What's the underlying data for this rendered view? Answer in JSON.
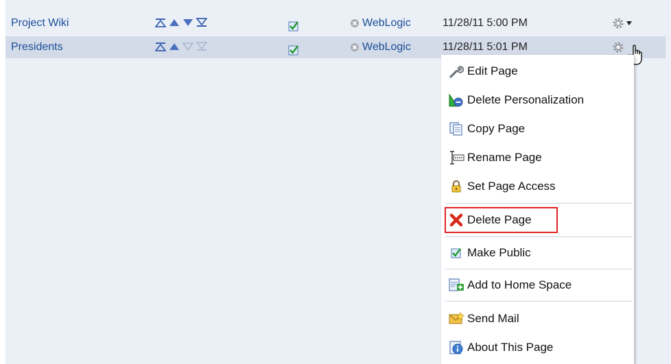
{
  "rows": [
    {
      "name": "Project Wiki",
      "published": true,
      "owner": "WebLogic",
      "modified": "11/28/11 5:00 PM"
    },
    {
      "name": "Presidents",
      "published": true,
      "owner": "WebLogic",
      "modified": "11/28/11 5:01 PM"
    }
  ],
  "menu": {
    "items": [
      {
        "label": "Edit Page",
        "icon": "wrench-icon"
      },
      {
        "label": "Delete Personalization",
        "icon": "delete-personalization-icon"
      },
      {
        "label": "Copy Page",
        "icon": "copy-page-icon"
      },
      {
        "label": "Rename Page",
        "icon": "rename-icon"
      },
      {
        "label": "Set Page Access",
        "icon": "lock-icon"
      },
      {
        "label": "Delete Page",
        "icon": "red-x-icon",
        "highlighted": true
      },
      {
        "label": "Make Public",
        "icon": "checkbox-checked-icon"
      },
      {
        "label": "Add to Home Space",
        "icon": "add-to-home-icon"
      },
      {
        "label": "Send Mail",
        "icon": "mail-icon"
      },
      {
        "label": "About This Page",
        "icon": "info-icon"
      }
    ]
  },
  "colors": {
    "link": "#1a4d97",
    "selected_row": "#d3dbe8",
    "background": "#ebf0f7",
    "highlight_border": "#e02121"
  }
}
